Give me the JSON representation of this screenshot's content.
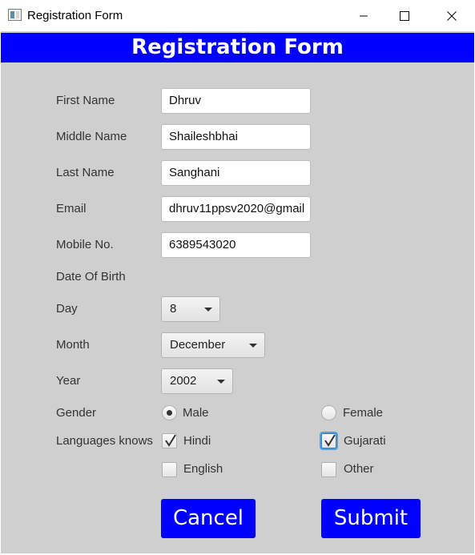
{
  "window": {
    "title": "Registration Form"
  },
  "form": {
    "heading": "Registration Form",
    "fields": {
      "first_name": {
        "label": "First Name",
        "value": "Dhruv"
      },
      "middle_name": {
        "label": "Middle Name",
        "value": "Shaileshbhai"
      },
      "last_name": {
        "label": "Last Name",
        "value": "Sanghani"
      },
      "email": {
        "label": "Email",
        "value": "dhruv11ppsv2020@gmail"
      },
      "mobile": {
        "label": "Mobile No.",
        "value": "6389543020"
      }
    },
    "dob": {
      "label": "Date Of Birth",
      "day": {
        "label": "Day",
        "selected": "8"
      },
      "month": {
        "label": "Month",
        "selected": "December"
      },
      "year": {
        "label": "Year",
        "selected": "2002"
      }
    },
    "gender": {
      "label": "Gender",
      "options": [
        {
          "label": "Male",
          "selected": true
        },
        {
          "label": "Female",
          "selected": false
        }
      ]
    },
    "languages": {
      "label": "Languages knows",
      "options": [
        {
          "label": "Hindi",
          "checked": true
        },
        {
          "label": "Gujarati",
          "checked": true
        },
        {
          "label": "English",
          "checked": false
        },
        {
          "label": "Other",
          "checked": false
        }
      ]
    },
    "buttons": {
      "cancel": "Cancel",
      "submit": "Submit"
    }
  },
  "colors": {
    "accent": "#0000ff",
    "panel_background": "#d0cfd0",
    "focus_ring": "#47a3e6"
  },
  "icons": {
    "app": "app-window-icon",
    "minimize": "minimize-icon",
    "maximize": "maximize-icon",
    "close": "close-icon",
    "dropdown": "chevron-down-icon",
    "check": "checkmark-icon"
  }
}
